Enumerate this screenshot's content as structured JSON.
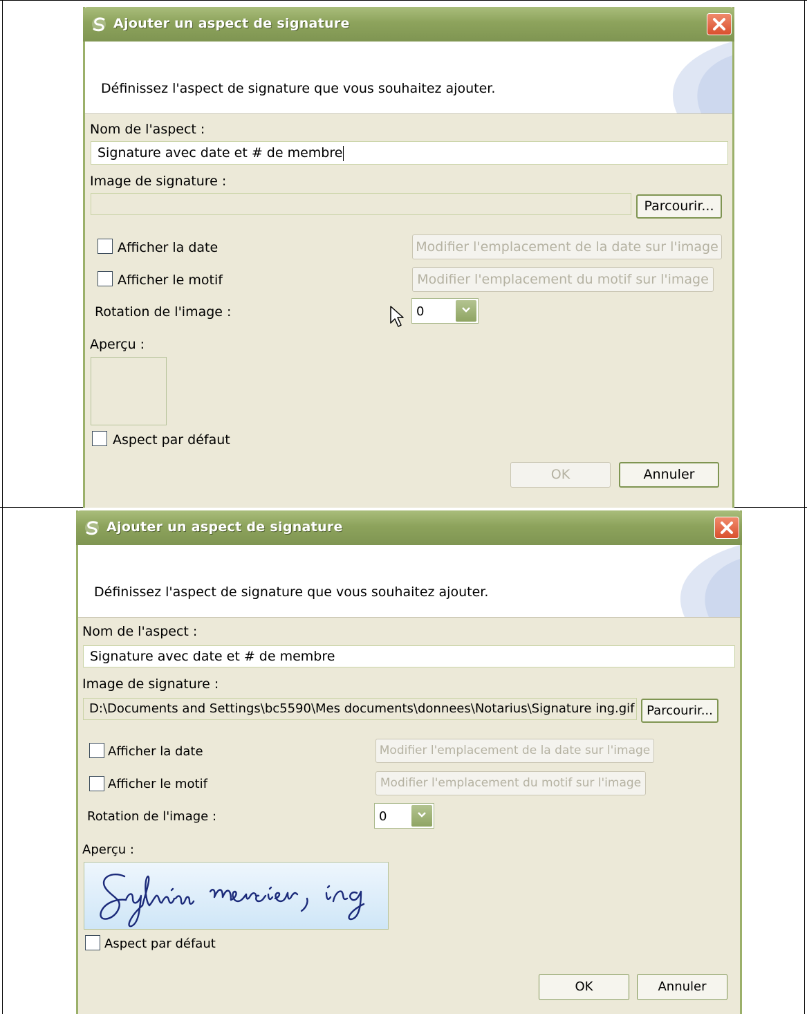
{
  "dialog1": {
    "title": "Ajouter un aspect de signature",
    "header_text": "Définissez l'aspect de signature que vous souhaitez ajouter.",
    "name_label": "Nom de l'aspect :",
    "name_value": "Signature avec date et # de membre",
    "image_label": "Image de signature :",
    "image_path": "",
    "browse_label": "Parcourir...",
    "show_date_label": "Afficher la date",
    "show_date_checked": false,
    "edit_date_label": "Modifier l'emplacement de la date sur l'image",
    "show_reason_label": "Afficher le motif",
    "show_reason_checked": false,
    "edit_reason_label": "Modifier l'emplacement du motif sur l'image",
    "rotation_label": "Rotation de l'image :",
    "rotation_value": "0",
    "preview_label": "Aperçu :",
    "default_label": "Aspect par défaut",
    "default_checked": false,
    "ok_label": "OK",
    "ok_enabled": false,
    "cancel_label": "Annuler"
  },
  "dialog2": {
    "title": "Ajouter un aspect de signature",
    "header_text": "Définissez l'aspect de signature que vous souhaitez ajouter.",
    "name_label": "Nom de l'aspect :",
    "name_value": "Signature avec date et # de membre",
    "image_label": "Image de signature :",
    "image_path": "D:\\Documents and Settings\\bc5590\\Mes documents\\donnees\\Notarius\\Signature ing.gif",
    "browse_label": "Parcourir...",
    "show_date_label": "Afficher la date",
    "show_date_checked": false,
    "edit_date_label": "Modifier l'emplacement de la date sur l'image",
    "show_reason_label": "Afficher le motif",
    "show_reason_checked": false,
    "edit_reason_label": "Modifier l'emplacement du motif sur l'image",
    "rotation_label": "Rotation de l'image :",
    "rotation_value": "0",
    "preview_label": "Aperçu :",
    "default_label": "Aspect par défaut",
    "default_checked": false,
    "ok_label": "OK",
    "ok_enabled": true,
    "cancel_label": "Annuler"
  },
  "colors": {
    "title_bar": "#8da35c",
    "dialog_bg": "#ece9d8",
    "close_button": "#d9502e",
    "signature_ink": "#1b2a7a",
    "preview_bg": "#cfe6f7"
  },
  "icons": [
    "app-icon",
    "close-icon",
    "chevron-down-icon",
    "mouse-cursor-icon"
  ]
}
